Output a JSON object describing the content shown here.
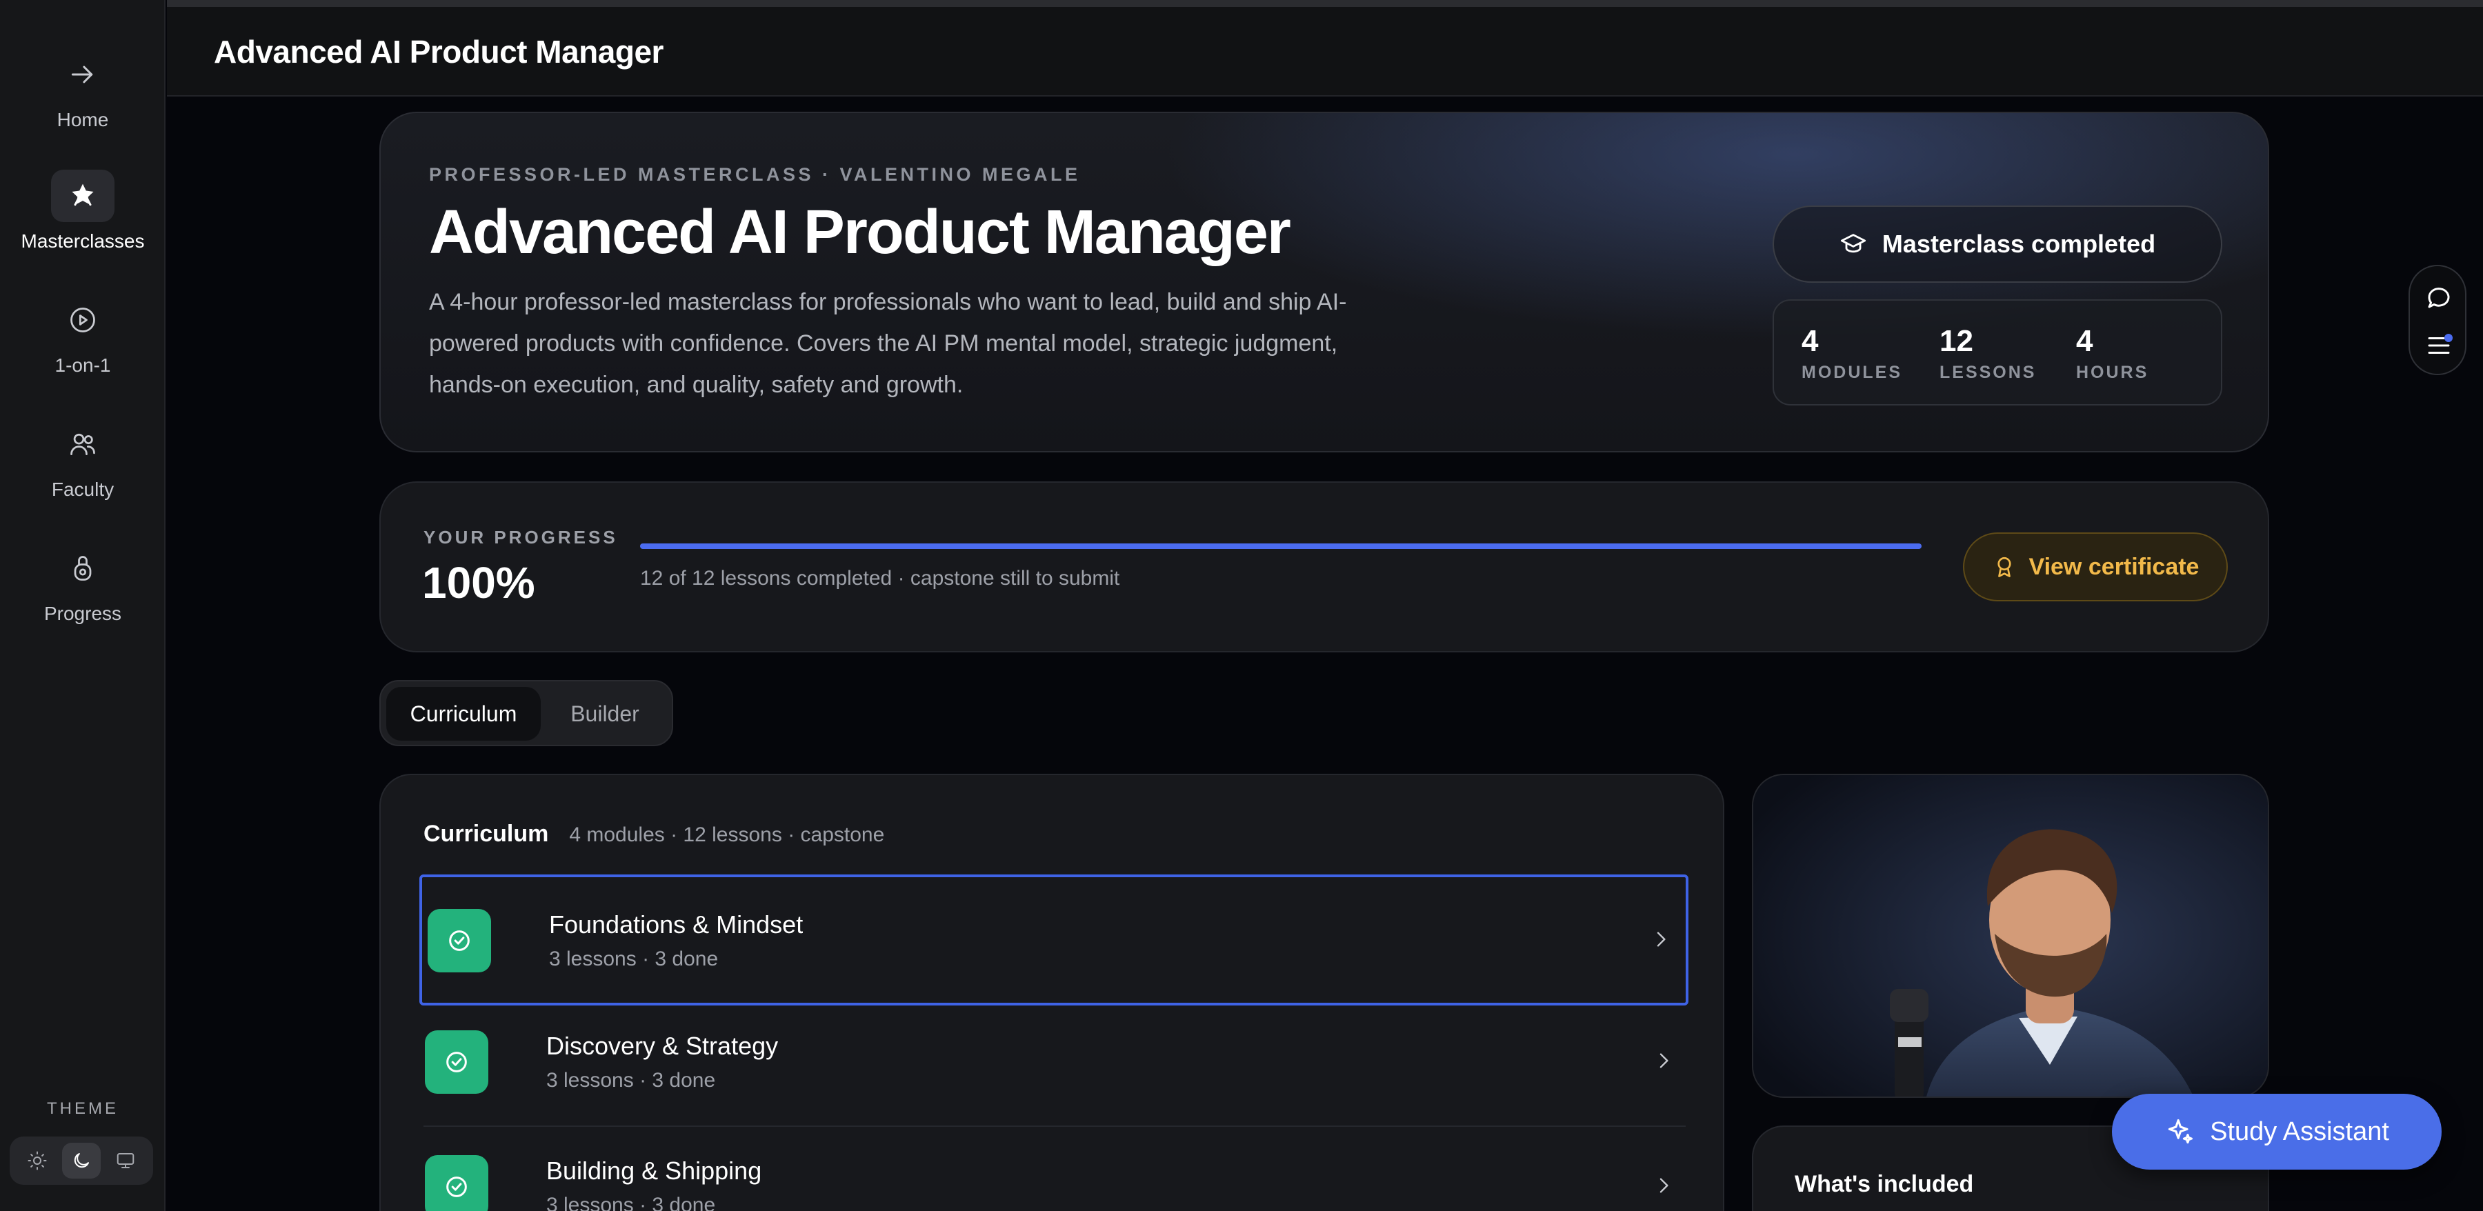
{
  "sidebar": {
    "items": [
      {
        "label": "Home",
        "icon": "arrow-right-icon"
      },
      {
        "label": "Masterclasses",
        "icon": "star-badge-icon"
      },
      {
        "label": "1-on-1",
        "icon": "play-circle-icon"
      },
      {
        "label": "Faculty",
        "icon": "users-icon"
      },
      {
        "label": "Progress",
        "icon": "target-lock-icon"
      }
    ],
    "active": "Masterclasses",
    "theme_title": "THEME",
    "theme_modes": [
      "light",
      "dark",
      "system"
    ],
    "theme_selected": "dark"
  },
  "topbar": {
    "title": "Advanced AI Product Manager"
  },
  "hero": {
    "eyebrow": "PROFESSOR-LED MASTERCLASS · VALENTINO MEGALE",
    "title": "Advanced AI Product Manager",
    "description": "A 4-hour professor-led masterclass for professionals who want to lead, build and ship AI-powered products with confidence. Covers the AI PM mental model, strategic judgment, hands-on execution, and quality, safety and growth.",
    "status_label": "Masterclass completed",
    "stats": [
      {
        "value": "4",
        "label": "MODULES"
      },
      {
        "value": "12",
        "label": "LESSONS"
      },
      {
        "value": "4",
        "label": "HOURS"
      }
    ]
  },
  "progress": {
    "label": "YOUR PROGRESS",
    "percent_label": "100%",
    "fraction": 1.0,
    "summary": "12 of 12 lessons completed · capstone still to submit",
    "certificate_button": "View certificate"
  },
  "tabs": [
    {
      "label": "Curriculum",
      "active": true
    },
    {
      "label": "Builder",
      "active": false
    }
  ],
  "curriculum": {
    "title": "Curriculum",
    "meta": "4 modules · 12 lessons · capstone",
    "modules": [
      {
        "name": "Foundations & Mindset",
        "sub": "3 lessons · 3 done"
      },
      {
        "name": "Discovery & Strategy",
        "sub": "3 lessons · 3 done"
      },
      {
        "name": "Building & Shipping",
        "sub": "3 lessons · 3 done"
      }
    ]
  },
  "included": {
    "title": "What's included"
  },
  "assistant": {
    "label": "Study Assistant"
  },
  "colors": {
    "accent": "#4b6cf0",
    "success": "#23b27c",
    "gold": "#f2b94a",
    "background": "#05060b",
    "sidebar": "#161719"
  }
}
